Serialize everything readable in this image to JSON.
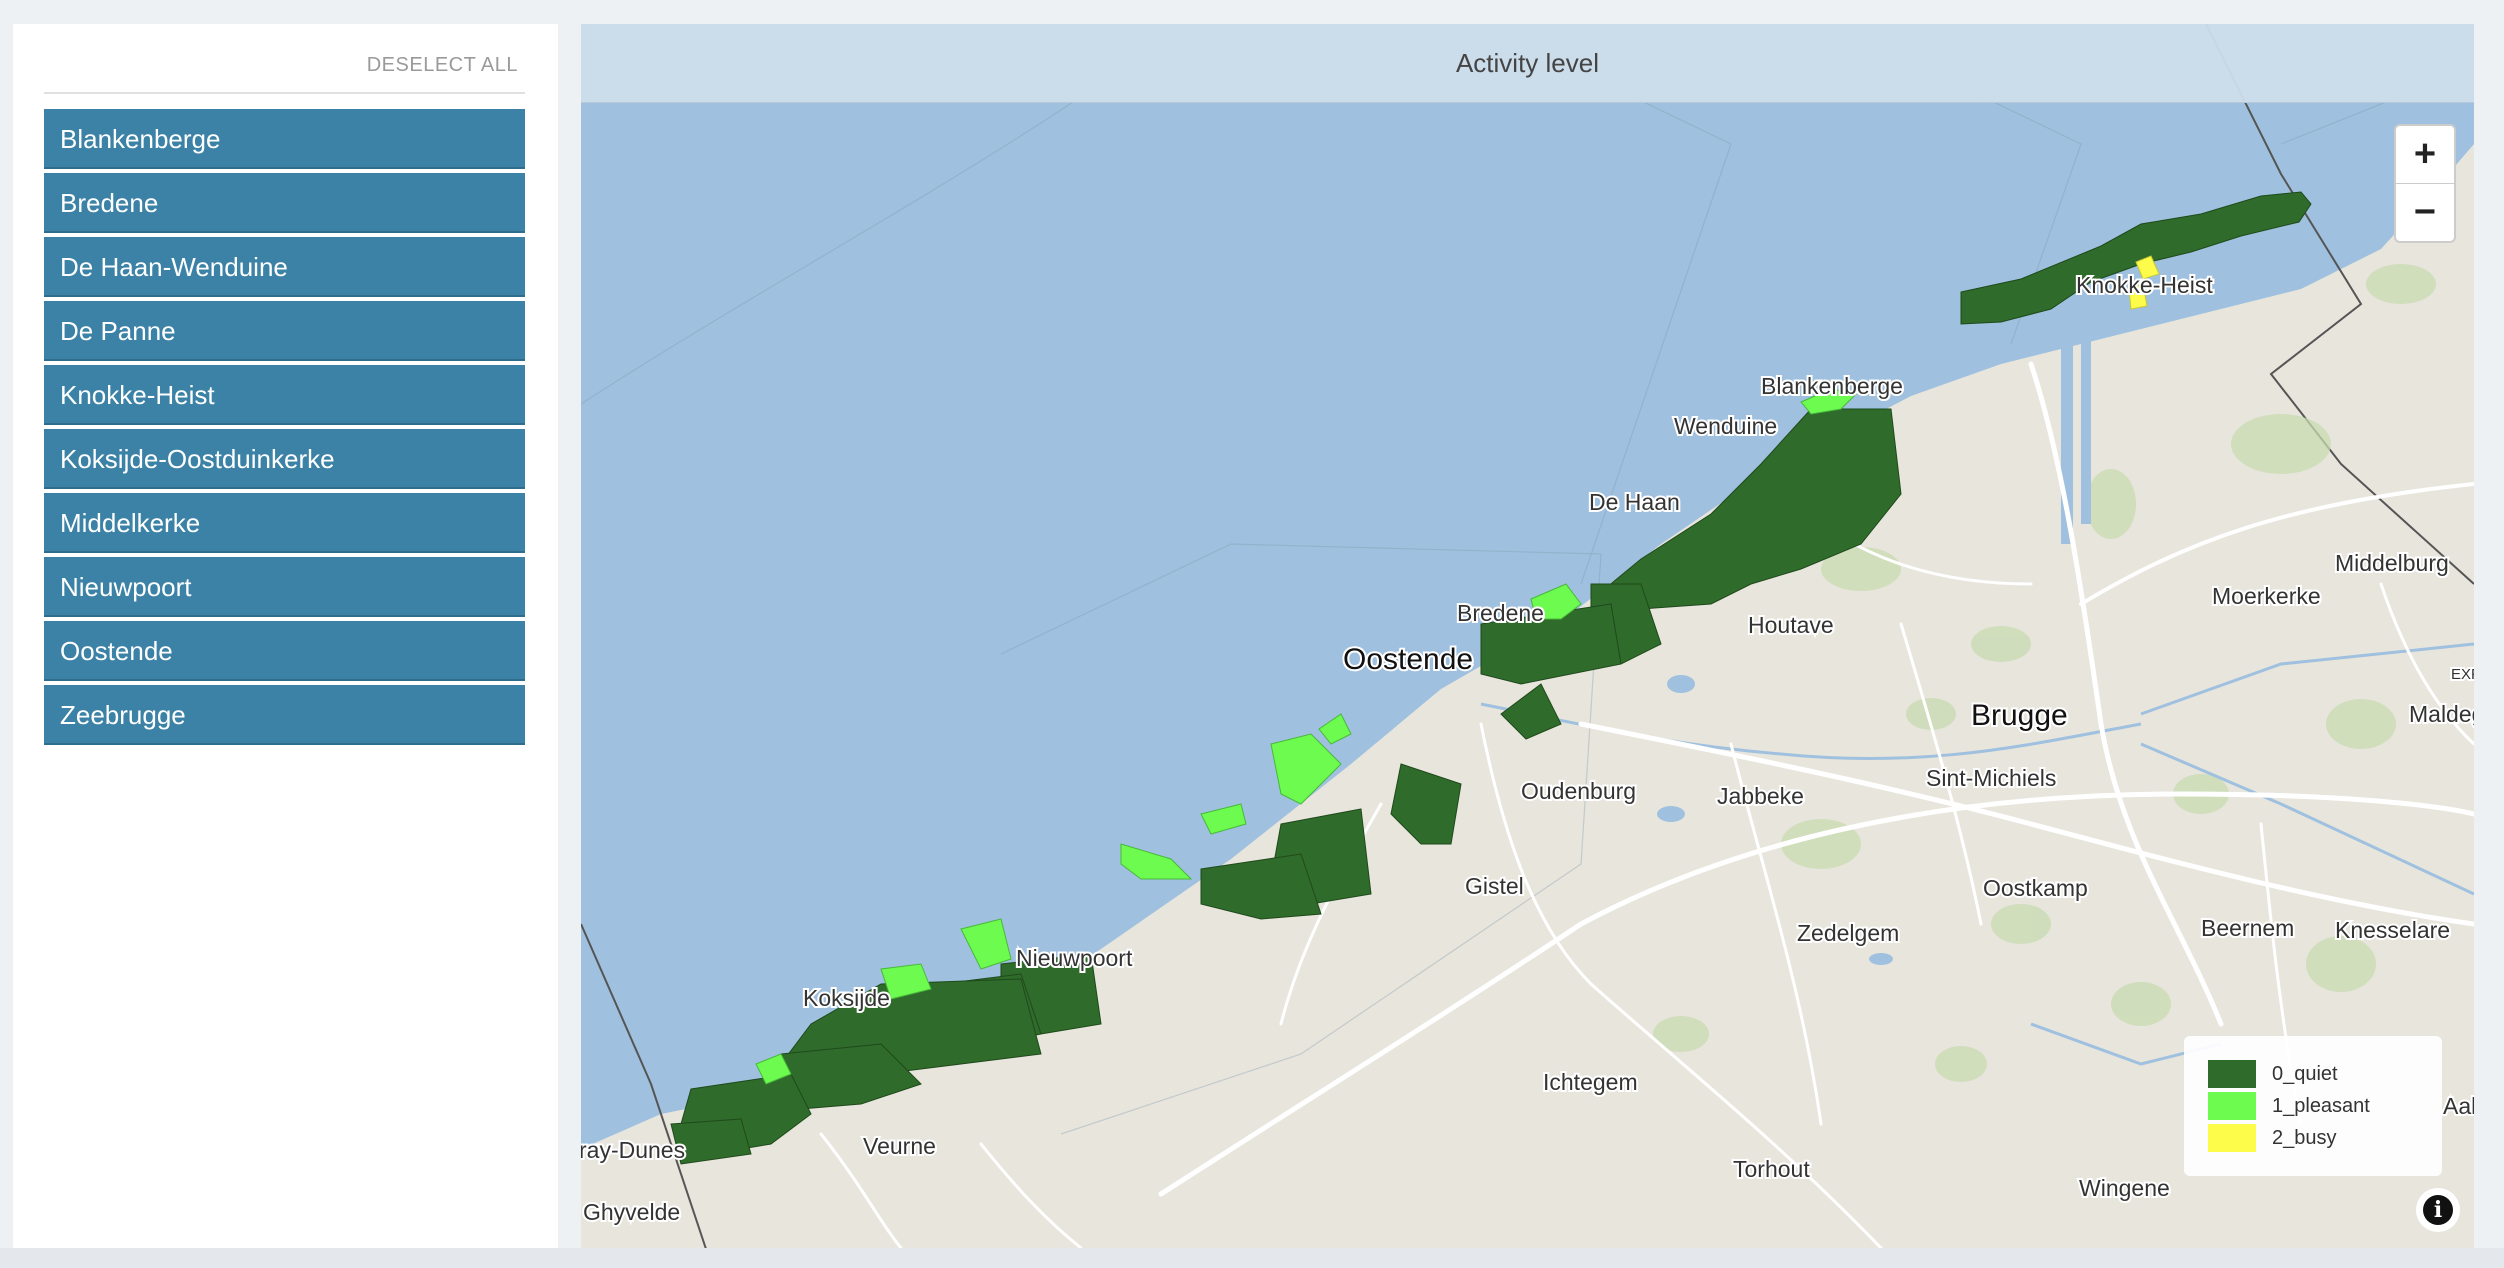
{
  "sidebar": {
    "deselect_label": "DESELECT ALL",
    "items": [
      {
        "label": "Blankenberge"
      },
      {
        "label": "Bredene"
      },
      {
        "label": "De Haan-Wenduine"
      },
      {
        "label": "De Panne"
      },
      {
        "label": "Knokke-Heist"
      },
      {
        "label": "Koksijde-Oostduinkerke"
      },
      {
        "label": "Middelkerke"
      },
      {
        "label": "Nieuwpoort"
      },
      {
        "label": "Oostende"
      },
      {
        "label": "Zeebrugge"
      }
    ]
  },
  "map": {
    "title": "Activity level",
    "zoom_in": "+",
    "zoom_out": "−",
    "info": "i",
    "colors": {
      "sea": "#9fc1df",
      "land": "#e8e5dc",
      "quiet": "#2f6b2a",
      "pleasant": "#6dfb50",
      "busy": "#fdfc4a"
    },
    "legend": [
      {
        "label": "0_quiet",
        "color": "#2f6b2a"
      },
      {
        "label": "1_pleasant",
        "color": "#6dfb50"
      },
      {
        "label": "2_busy",
        "color": "#fdfc4a"
      }
    ],
    "places": {
      "knokke": "Knokke-Heist",
      "blankenberge": "Blankenberge",
      "wenduine": "Wenduine",
      "dehaan": "De Haan",
      "bredene": "Bredene",
      "oostende": "Oostende",
      "houtave": "Houtave",
      "middelburg": "Middelburg",
      "moerkerke": "Moerkerke",
      "brugge": "Brugge",
      "maldeg": "Maldeg",
      "exf": "EXF",
      "sintmichiels": "Sint-Michiels",
      "oudenburg": "Oudenburg",
      "jabbeke": "Jabbeke",
      "gistel": "Gistel",
      "oostkamp": "Oostkamp",
      "zedelgem": "Zedelgem",
      "beernem": "Beernem",
      "knesselare": "Knesselare",
      "nieuwpoort": "Nieuwpoort",
      "koksijde": "Koksijde",
      "ichtegem": "Ichtegem",
      "aalt": "Aalt",
      "raydunes": "ray-Dunes",
      "veurne": "Veurne",
      "torhout": "Torhout",
      "wingene": "Wingene",
      "ghyvelde": "Ghyvelde"
    }
  }
}
